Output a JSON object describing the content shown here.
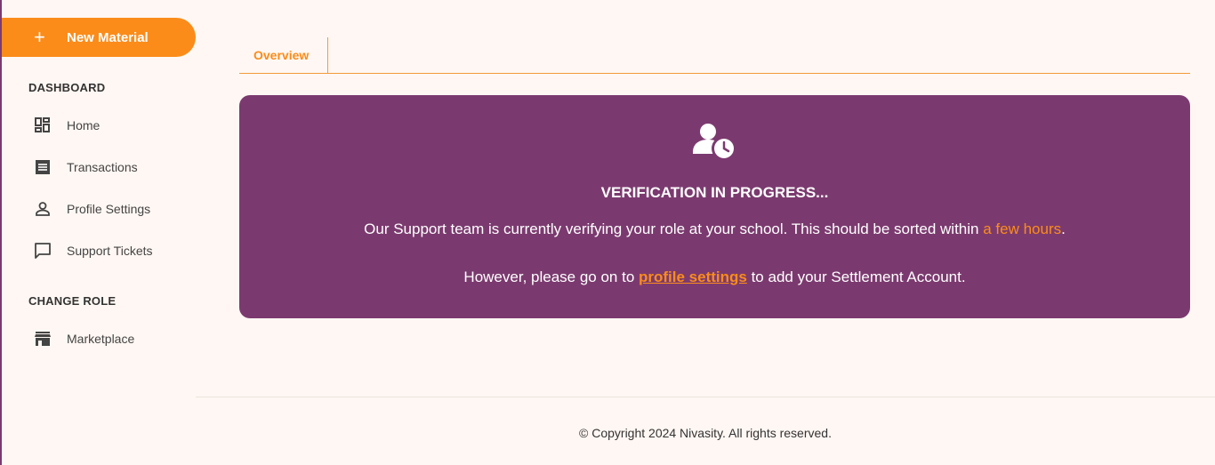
{
  "sidebar": {
    "new_button": {
      "label": "New Material",
      "icon": "plus-icon"
    },
    "sections": [
      {
        "title": "DASHBOARD",
        "items": [
          {
            "label": "Home",
            "icon": "dashboard-grid-icon"
          },
          {
            "label": "Transactions",
            "icon": "receipt-icon"
          },
          {
            "label": "Profile Settings",
            "icon": "person-icon"
          },
          {
            "label": "Support Tickets",
            "icon": "chat-bubble-icon"
          }
        ]
      },
      {
        "title": "CHANGE ROLE",
        "items": [
          {
            "label": "Marketplace",
            "icon": "storefront-icon"
          }
        ]
      }
    ]
  },
  "tabs": [
    {
      "label": "Overview",
      "active": true
    }
  ],
  "verification": {
    "icon": "user-clock-icon",
    "title": "VERIFICATION IN PROGRESS...",
    "line1_before": "Our Support team is currently verifying your role at your school. This should be sorted within ",
    "line1_highlight": "a few hours",
    "line1_after": ".",
    "line2_before": "However, please go on to ",
    "line2_link": "profile settings",
    "line2_after": " to add your Settlement Account."
  },
  "footer": {
    "text": "© Copyright 2024 Nivasity. All rights reserved."
  },
  "colors": {
    "accent": "#fb8c1a",
    "brand_purple": "#7b3a6f",
    "background": "#fff7f3"
  }
}
